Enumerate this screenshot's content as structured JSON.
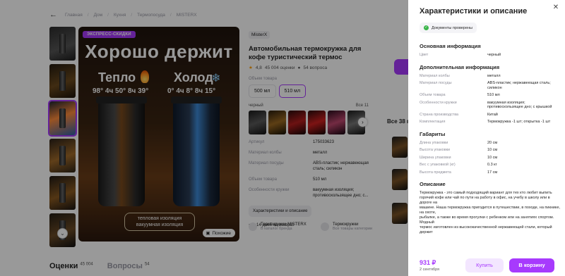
{
  "breadcrumbs": [
    "Главная",
    "Дом",
    "Кухня",
    "Термопосуда",
    "MISTERX"
  ],
  "gallery": {
    "express_badge": "ЭКСПРЕСС-СКИДКИ",
    "headline": "Хорошо держит",
    "warm_word": "Тепло",
    "cold_word": "Холод",
    "warm_temps": "98° 4ч 50° 8ч 39°",
    "cold_temps": "0° 4ч 8° 8ч 15°",
    "insulation_label": "тепловая изоляция вакуумная изоляция",
    "similar_button": "Похожие"
  },
  "product": {
    "brand": "MisterX",
    "title": "Автомобильная термокружка для кофе туристический термос",
    "rating": "4,8",
    "reviews": "45 004 оценки",
    "questions": "54 вопроса",
    "volume_label": "Объем товара",
    "sizes": [
      "500 мл",
      "510 мл"
    ],
    "color_label": "черный",
    "all_colors": "Все 11",
    "specs": [
      {
        "k": "Артикул",
        "v": "175033623"
      },
      {
        "k": "Материал колбы",
        "v": "металл"
      },
      {
        "k": "Материал посуды",
        "v": "ABS-пластик; нержавеющая сталь; силикон"
      },
      {
        "k": "Объем товара",
        "v": "510 мл"
      },
      {
        "k": "Особенности кружки",
        "v": "вакуумная изоляция; противоскользящее дно; с..."
      }
    ],
    "specs_button": "Характеристики и описание",
    "returns": "14 дней на возврат",
    "stores": [
      {
        "name": "Термокружки MISTERX",
        "sub": "В каталог бренда"
      },
      {
        "name": "Термокружки",
        "sub": "Все товары категории"
      }
    ]
  },
  "tabs": [
    {
      "label": "Оценки",
      "count": "45 004"
    },
    {
      "label": "Вопросы",
      "count": "54"
    }
  ],
  "right_column": {
    "all_label": "Все 38 п"
  },
  "panel": {
    "title": "Характеристики и описание",
    "docs_badge": "Документы проверены",
    "sections": [
      {
        "title": "Основная информация",
        "rows": [
          {
            "k": "Цвет",
            "v": "черный"
          }
        ]
      },
      {
        "title": "Дополнительная информация",
        "rows": [
          {
            "k": "Материал колбы",
            "v": "металл"
          },
          {
            "k": "Материал посуды",
            "v": "ABS-пластик; нержавеющая сталь; силикон"
          },
          {
            "k": "Объем товара",
            "v": "510 мл"
          },
          {
            "k": "Особенности кружки",
            "v": "вакуумная изоляция; противоскользящее дно; с крышкой"
          },
          {
            "k": "Страна производства",
            "v": "Китай"
          },
          {
            "k": "Комплектация",
            "v": "Термокружка -1 шт; открытка -1 шт"
          }
        ]
      },
      {
        "title": "Габариты",
        "rows": [
          {
            "k": "Длина упаковки",
            "v": "20 см"
          },
          {
            "k": "Высота упаковки",
            "v": "10 см"
          },
          {
            "k": "Ширина упаковки",
            "v": "10 см"
          },
          {
            "k": "Вес с упаковкой (кг)",
            "v": "0.3 кг"
          },
          {
            "k": "Высота предмета",
            "v": "17 см"
          }
        ]
      }
    ],
    "description_title": "Описание",
    "description_lines": [
      "Термокружка - это самый подходящий вариант для тех кто любит выпить",
      "горячий кофе или чай по пути на работу в офис, на учебу в школу или в дорогe на",
      "машине. Наша термокружка пригодится в путешествии, в походе, на пикнике, на охоте,",
      "рыбалке, а также во время прогулки с ребенком или на занятиях спортом. Модный",
      "термос изготовлен из высококачественной нержавеющей стали, который держит"
    ],
    "price": "931 ₽",
    "delivery_date": "2 сентября",
    "buy_button": "Купить",
    "cart_button": "В корзину"
  }
}
